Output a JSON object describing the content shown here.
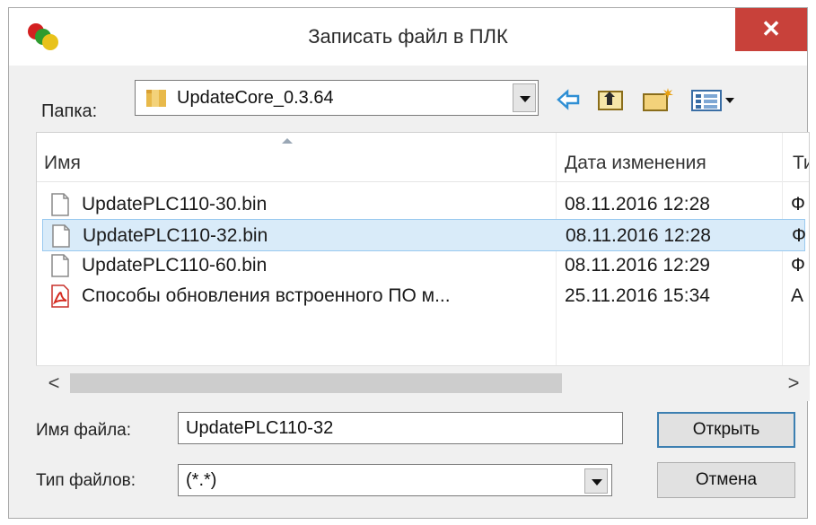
{
  "window": {
    "title": "Записать файл в ПЛК",
    "close": "✕"
  },
  "folder": {
    "label": "Папка:",
    "value": "UpdateCore_0.3.64"
  },
  "toolbar": {
    "back_icon": "arrow-left-icon",
    "up_icon": "folder-up-icon",
    "new_icon": "new-folder-icon",
    "view_icon": "view-menu-icon"
  },
  "list": {
    "columns": [
      "Имя",
      "Дата изменения",
      "Ти"
    ],
    "rows": [
      {
        "name": "UpdatePLC110-30.bin",
        "date": "08.11.2016 12:28",
        "type": "Ф",
        "icon": "file-icon",
        "selected": false
      },
      {
        "name": "UpdatePLC110-32.bin",
        "date": "08.11.2016 12:28",
        "type": "Ф",
        "icon": "file-icon",
        "selected": true
      },
      {
        "name": "UpdatePLC110-60.bin",
        "date": "08.11.2016 12:29",
        "type": "Ф",
        "icon": "file-icon",
        "selected": false
      },
      {
        "name": "Способы обновления встроенного ПО м...",
        "date": "25.11.2016 15:34",
        "type": "А",
        "icon": "pdf-icon",
        "selected": false
      }
    ],
    "scroll_left": "<",
    "scroll_right": ">"
  },
  "filename": {
    "label": "Имя файла:",
    "value": "UpdatePLC110-32"
  },
  "filetype": {
    "label": "Тип файлов:",
    "value": "(*.*)"
  },
  "buttons": {
    "open": "Открыть",
    "cancel": "Отмена"
  },
  "colors": {
    "close_bg": "#c8413a",
    "selection_bg": "#d9ebf9",
    "selection_border": "#99c9ef",
    "default_button_border": "#3c7fb1"
  }
}
